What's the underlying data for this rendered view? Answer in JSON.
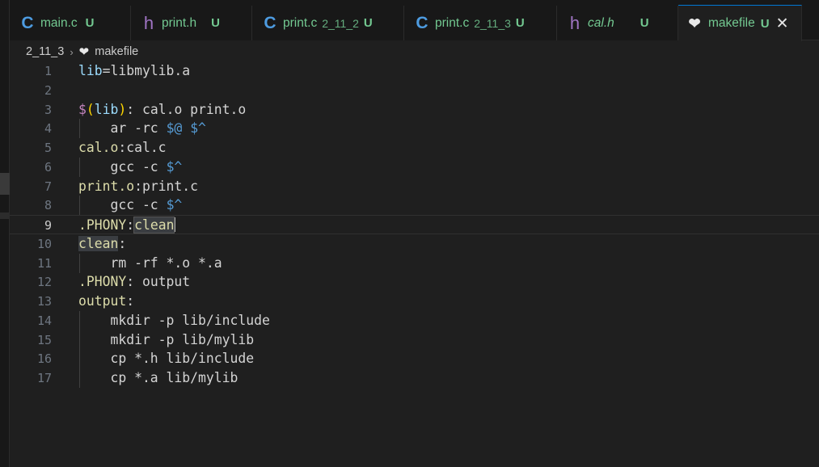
{
  "tabs": [
    {
      "icon": "C",
      "name": "main.c",
      "dir": "",
      "status": "U",
      "active": false
    },
    {
      "icon": "h",
      "name": "print.h",
      "dir": "",
      "status": "U",
      "active": false
    },
    {
      "icon": "C",
      "name": "print.c",
      "dir": "2_11_2",
      "status": "U",
      "active": false
    },
    {
      "icon": "C",
      "name": "print.c",
      "dir": "2_11_3",
      "status": "U",
      "active": false
    },
    {
      "icon": "h",
      "name": "cal.h",
      "dir": "",
      "status": "U",
      "active": false
    },
    {
      "icon": "❤",
      "name": "makefile",
      "dir": "",
      "status": "U",
      "close": "✕",
      "active": true
    }
  ],
  "breadcrumb": {
    "folder": "2_11_3",
    "separator": "›",
    "file_icon": "❤",
    "file": "makefile"
  },
  "editor": {
    "current_line": 9,
    "line_numbers": [
      "1",
      "2",
      "3",
      "4",
      "5",
      "6",
      "7",
      "8",
      "9",
      "10",
      "11",
      "12",
      "13",
      "14",
      "15",
      "16",
      "17"
    ],
    "lines": [
      [
        {
          "t": "lib",
          "c": "var"
        },
        {
          "t": "=libmylib.a",
          "c": "plain"
        }
      ],
      [],
      [
        {
          "t": "$",
          "c": "dollar"
        },
        {
          "t": "(",
          "c": "paren"
        },
        {
          "t": "lib",
          "c": "var"
        },
        {
          "t": ")",
          "c": "paren"
        },
        {
          "t": ": cal.o print.o",
          "c": "plain"
        }
      ],
      [
        {
          "t": "    ar -rc ",
          "c": "plain"
        },
        {
          "t": "$@",
          "c": "auto"
        },
        {
          "t": " ",
          "c": "plain"
        },
        {
          "t": "$^",
          "c": "auto"
        }
      ],
      [
        {
          "t": "cal.o",
          "c": "yel"
        },
        {
          "t": ":cal.c",
          "c": "plain"
        }
      ],
      [
        {
          "t": "    gcc -c ",
          "c": "plain"
        },
        {
          "t": "$^",
          "c": "auto"
        }
      ],
      [
        {
          "t": "print.o",
          "c": "yel"
        },
        {
          "t": ":print.c",
          "c": "plain"
        }
      ],
      [
        {
          "t": "    gcc -c ",
          "c": "plain"
        },
        {
          "t": "$^",
          "c": "auto"
        }
      ],
      [
        {
          "t": ".PHONY",
          "c": "yel"
        },
        {
          "t": ":",
          "c": "plain"
        },
        {
          "t": "clean",
          "c": "sel"
        }
      ],
      [
        {
          "t": "clean",
          "c": "hl-yel"
        },
        {
          "t": ":",
          "c": "plain"
        }
      ],
      [
        {
          "t": "    rm -rf *.o *.a",
          "c": "plain"
        }
      ],
      [
        {
          "t": ".PHONY",
          "c": "yel"
        },
        {
          "t": ": output",
          "c": "plain"
        }
      ],
      [
        {
          "t": "output",
          "c": "yel"
        },
        {
          "t": ":",
          "c": "plain"
        }
      ],
      [
        {
          "t": "    mkdir -p lib/include",
          "c": "plain"
        }
      ],
      [
        {
          "t": "    mkdir -p lib/mylib",
          "c": "plain"
        }
      ],
      [
        {
          "t": "    cp *.h lib/include",
          "c": "plain"
        }
      ],
      [
        {
          "t": "    cp *.a lib/mylib",
          "c": "plain"
        }
      ]
    ]
  },
  "colors": {
    "background": "#1f1f1f",
    "tab_untracked": "#73c991",
    "c_icon": "#4d9be0",
    "h_icon": "#a074c4",
    "target": "#dcdcaa",
    "variable": "#9cdcfe",
    "automatic_var": "#569cd6"
  }
}
